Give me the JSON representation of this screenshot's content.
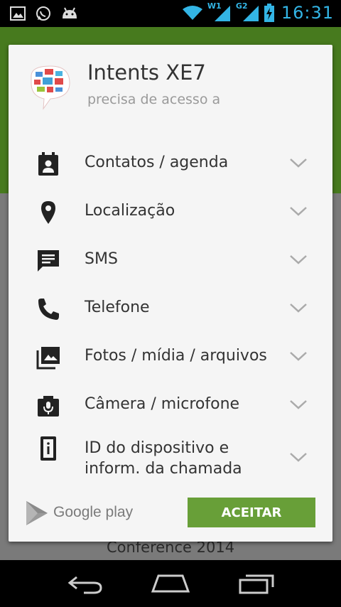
{
  "status_bar": {
    "time": "16:31",
    "sim1_label": "W1",
    "sim2_label": "G2",
    "accent_color": "#33b5e5",
    "left_icons": [
      "image-icon",
      "whatsapp-icon",
      "android-icon"
    ]
  },
  "background": {
    "footer_text": "Conference 2014"
  },
  "dialog": {
    "app_name": "Intents XE7",
    "subtitle": "precisa de acesso a",
    "permissions": [
      {
        "icon": "contact-calendar-icon",
        "label": "Contatos / agenda"
      },
      {
        "icon": "location-pin-icon",
        "label": "Localização"
      },
      {
        "icon": "sms-icon",
        "label": "SMS"
      },
      {
        "icon": "phone-icon",
        "label": "Telefone"
      },
      {
        "icon": "photos-media-icon",
        "label": "Fotos / mídia / arquivos"
      },
      {
        "icon": "camera-mic-icon",
        "label": "Câmera / microfone"
      },
      {
        "icon": "device-id-icon",
        "label_line1": "ID do dispositivo e",
        "label_line2": "inform. da chamada"
      }
    ],
    "store_brand": "Google play",
    "accept_label": "ACEITAR",
    "accept_color": "#689f38"
  },
  "nav": {
    "buttons": [
      "back-icon",
      "home-icon",
      "recents-icon"
    ]
  }
}
